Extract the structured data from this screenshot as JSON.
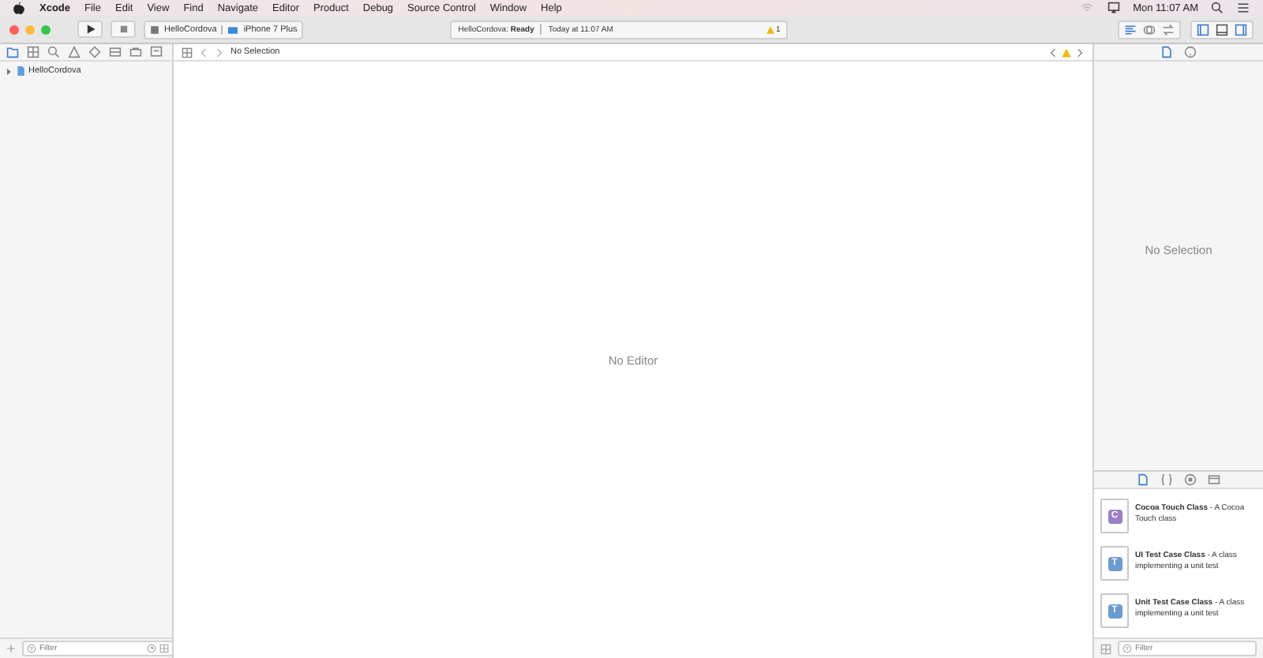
{
  "menu_bar": {
    "app": "Xcode",
    "items": [
      "File",
      "Edit",
      "View",
      "Find",
      "Navigate",
      "Editor",
      "Product",
      "Debug",
      "Source Control",
      "Window",
      "Help"
    ],
    "clock": "Mon 11:07 AM"
  },
  "toolbar": {
    "scheme": "HelloCordova",
    "device": "iPhone 7 Plus",
    "activity": {
      "project": "HelloCordova:",
      "status": "Ready",
      "time": "Today at 11:07 AM",
      "warnings": "1"
    }
  },
  "navigator": {
    "tree": [
      {
        "label": "HelloCordova",
        "expanded": false
      }
    ],
    "filter": {
      "placeholder": "Filter"
    }
  },
  "editor": {
    "jump_bar": "No Selection",
    "message": "No Editor"
  },
  "inspector": {
    "tabs": [
      {
        "kind": "file",
        "selected": true
      },
      {
        "kind": "help",
        "selected": false
      }
    ],
    "message": "No Selection"
  },
  "library": {
    "tabs": [
      {
        "kind": "file",
        "selected": true
      },
      {
        "kind": "code",
        "selected": false
      },
      {
        "kind": "object",
        "selected": false
      },
      {
        "kind": "media",
        "selected": false
      }
    ],
    "items": [
      {
        "icon": "C",
        "color": "#9b7fc8",
        "title": "Cocoa Touch Class",
        "description": " - A Cocoa Touch class"
      },
      {
        "icon": "T",
        "color": "#6a9bd2",
        "title": "UI Test Case Class",
        "description": " - A class implementing a unit test"
      },
      {
        "icon": "T",
        "color": "#6a9bd2",
        "title": "Unit Test Case Class",
        "description": " - A class implementing a unit test"
      }
    ],
    "filter": {
      "placeholder": "Filter"
    }
  }
}
